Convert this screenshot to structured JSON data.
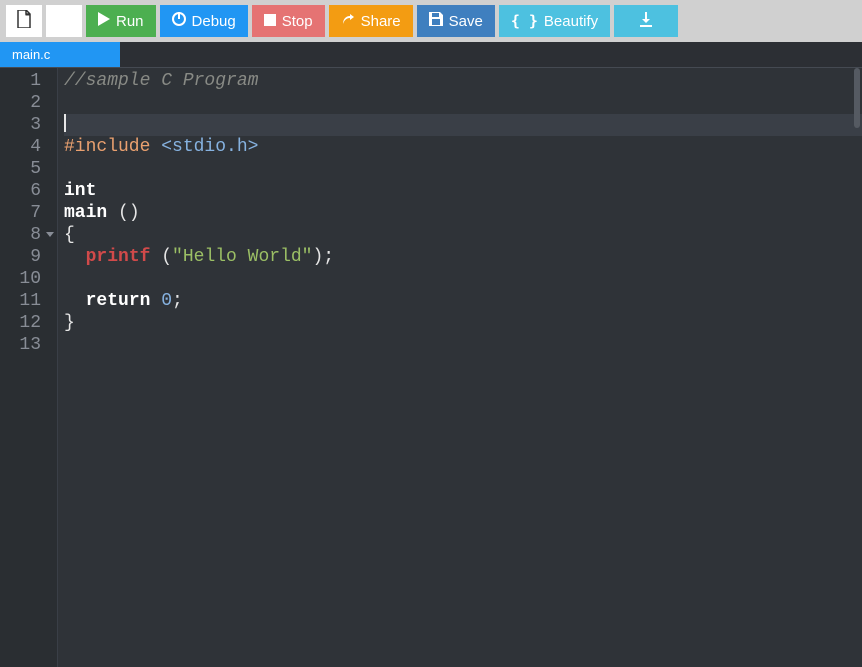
{
  "toolbar": {
    "run_label": "Run",
    "debug_label": "Debug",
    "stop_label": "Stop",
    "share_label": "Share",
    "save_label": "Save",
    "beautify_label": "Beautify"
  },
  "tabs": {
    "active": "main.c"
  },
  "gutter": {
    "lines": [
      "1",
      "2",
      "3",
      "4",
      "5",
      "6",
      "7",
      "8",
      "9",
      "10",
      "11",
      "12",
      "13"
    ]
  },
  "code": {
    "l1_comment": "//sample C Program",
    "l4_prep": "#include",
    "l4_hdr": " <stdio.h>",
    "l6_kw": "int",
    "l7_fn": "main",
    "l7_paren": " ()",
    "l8_brace": "{",
    "l9_indent": "  ",
    "l9_func": "printf",
    "l9_sp": " ",
    "l9_lpar": "(",
    "l9_str": "\"Hello World\"",
    "l9_rpar": ")",
    "l9_semi": ";",
    "l11_indent": "  ",
    "l11_kw": "return",
    "l11_sp": " ",
    "l11_num": "0",
    "l11_semi": ";",
    "l12_brace": "}"
  }
}
